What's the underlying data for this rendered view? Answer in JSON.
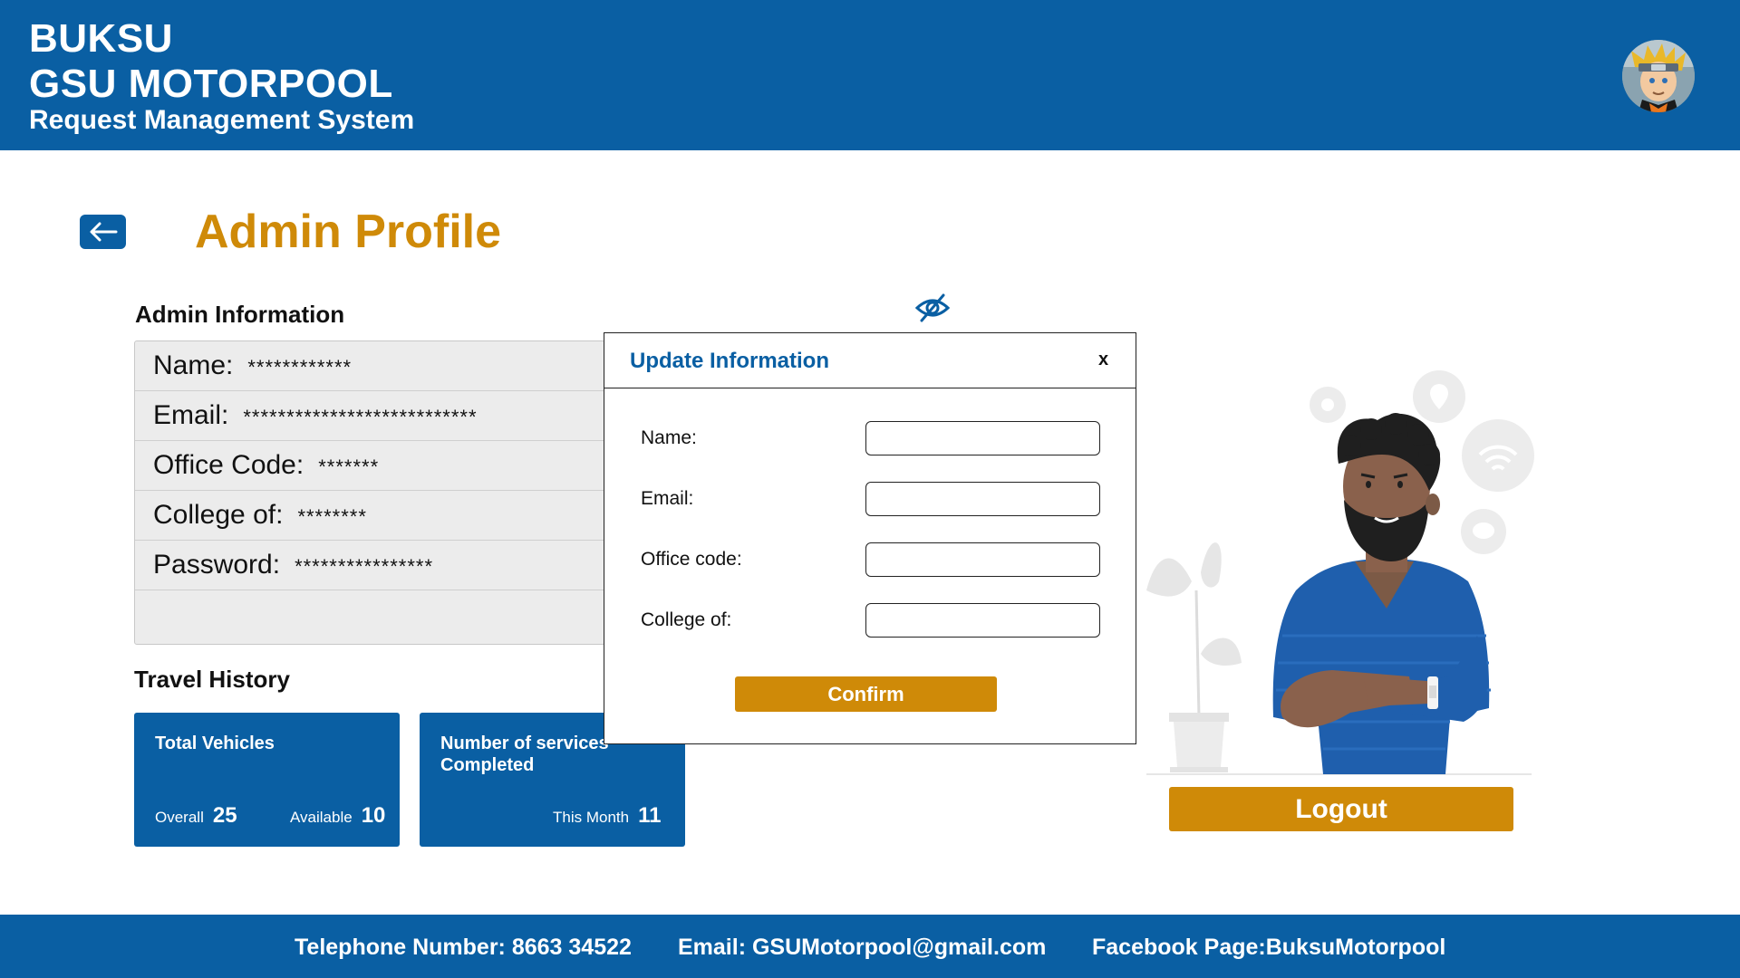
{
  "header": {
    "brand_line1": "BUKSU",
    "brand_line2": "GSU MOTORPOOL",
    "brand_line3": "Request Management System",
    "avatar_icon": "user-avatar"
  },
  "page": {
    "title": "Admin Profile",
    "back_icon": "arrow-left-icon"
  },
  "admin_info": {
    "section_title": "Admin Information",
    "rows": [
      {
        "label": "Name:",
        "value": "************"
      },
      {
        "label": "Email:",
        "value": "***************************"
      },
      {
        "label": "Office Code:",
        "value": "*******"
      },
      {
        "label": "College of:",
        "value": "********"
      },
      {
        "label": "Password:",
        "value": "****************"
      }
    ],
    "toggle_visibility_icon": "eye-slash-icon"
  },
  "travel_history": {
    "section_title": "Travel History",
    "cards": [
      {
        "title": "Total Vehicles",
        "stats": [
          {
            "label": "Overall",
            "value": "25"
          },
          {
            "label": "Available",
            "value": "10"
          }
        ]
      },
      {
        "title": "Number of services Completed",
        "stats": [
          {
            "label": "This Month",
            "value": "11"
          }
        ]
      }
    ]
  },
  "modal": {
    "title": "Update Information",
    "close_label": "x",
    "fields": [
      {
        "label": "Name:",
        "value": "",
        "placeholder": ""
      },
      {
        "label": "Email:",
        "value": "",
        "placeholder": ""
      },
      {
        "label": "Office code:",
        "value": "",
        "placeholder": ""
      },
      {
        "label": "College of:",
        "value": "",
        "placeholder": ""
      }
    ],
    "confirm_label": "Confirm"
  },
  "logout_label": "Logout",
  "footer": {
    "telephone": "Telephone Number: 8663 34522",
    "email": "Email: GSUMotorpool@gmail.com",
    "facebook": "Facebook Page:BuksuMotorpool"
  },
  "colors": {
    "primary": "#0a5fa3",
    "accent": "#cf8a08"
  }
}
